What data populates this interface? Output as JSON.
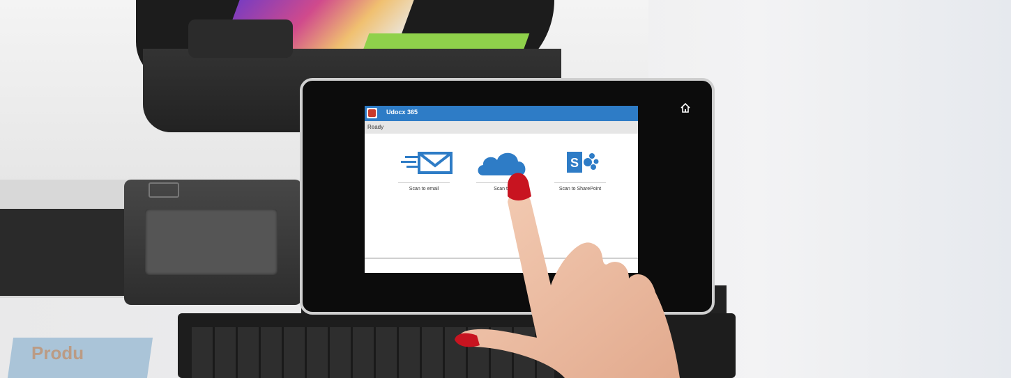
{
  "app": {
    "title": "Udocx 365",
    "status": "Ready",
    "accent_color": "#2e7cc6",
    "tiles": [
      {
        "label": "Scan to email",
        "icon": "email-icon"
      },
      {
        "label": "Scan to",
        "icon": "cloud-icon"
      },
      {
        "label": "Scan to SharePoint",
        "icon": "sharepoint-icon"
      }
    ],
    "home_icon": "home-icon"
  },
  "scene": {
    "brochure_text": "Produ"
  }
}
